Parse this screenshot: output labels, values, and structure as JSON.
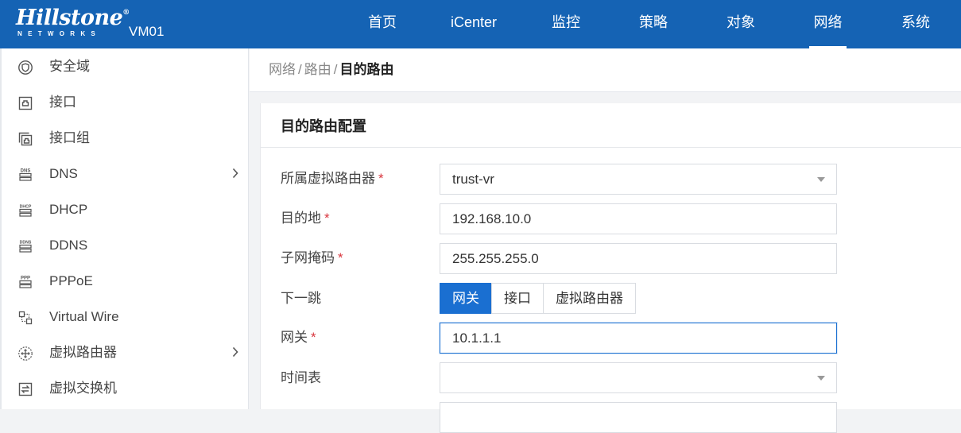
{
  "header": {
    "logo_text": "Hillstone",
    "logo_sub": "NETWORKS",
    "device": "VM01",
    "nav": [
      {
        "label": "首页"
      },
      {
        "label": "iCenter"
      },
      {
        "label": "监控"
      },
      {
        "label": "策略"
      },
      {
        "label": "对象"
      },
      {
        "label": "网络",
        "active": true
      },
      {
        "label": "系统"
      }
    ]
  },
  "sidebar": {
    "items": [
      {
        "label": "安全域",
        "icon": "security-zone-icon"
      },
      {
        "label": "接口",
        "icon": "interface-icon"
      },
      {
        "label": "接口组",
        "icon": "interface-group-icon"
      },
      {
        "label": "DNS",
        "icon": "dns-icon",
        "expandable": true
      },
      {
        "label": "DHCP",
        "icon": "dhcp-icon"
      },
      {
        "label": "DDNS",
        "icon": "ddns-icon"
      },
      {
        "label": "PPPoE",
        "icon": "pppoe-icon"
      },
      {
        "label": "Virtual Wire",
        "icon": "virtual-wire-icon"
      },
      {
        "label": "虚拟路由器",
        "icon": "virtual-router-icon",
        "expandable": true
      },
      {
        "label": "虚拟交换机",
        "icon": "virtual-switch-icon"
      }
    ],
    "icon_text": {
      "dns": "DNS",
      "dhcp": "DHCP",
      "ddns": "DDNS",
      "ppp": "PPP"
    }
  },
  "breadcrumb": {
    "items": [
      "网络",
      "路由"
    ],
    "separator": "/",
    "current": "目的路由"
  },
  "panel": {
    "title": "目的路由配置",
    "required_mark": "*",
    "fields": {
      "virtual_router": {
        "label": "所属虚拟路由器",
        "value": "trust-vr",
        "required": true
      },
      "destination": {
        "label": "目的地",
        "value": "192.168.10.0",
        "required": true
      },
      "netmask": {
        "label": "子网掩码",
        "value": "255.255.255.0",
        "required": true
      },
      "next_hop": {
        "label": "下一跳",
        "options": [
          "网关",
          "接口",
          "虚拟路由器"
        ],
        "selected": "网关"
      },
      "gateway": {
        "label": "网关",
        "value": "10.1.1.1",
        "required": true
      },
      "schedule": {
        "label": "时间表",
        "value": ""
      }
    }
  },
  "colors": {
    "header_bg": "#1563b4",
    "accent": "#1a6fd1",
    "required": "#d9363e"
  }
}
